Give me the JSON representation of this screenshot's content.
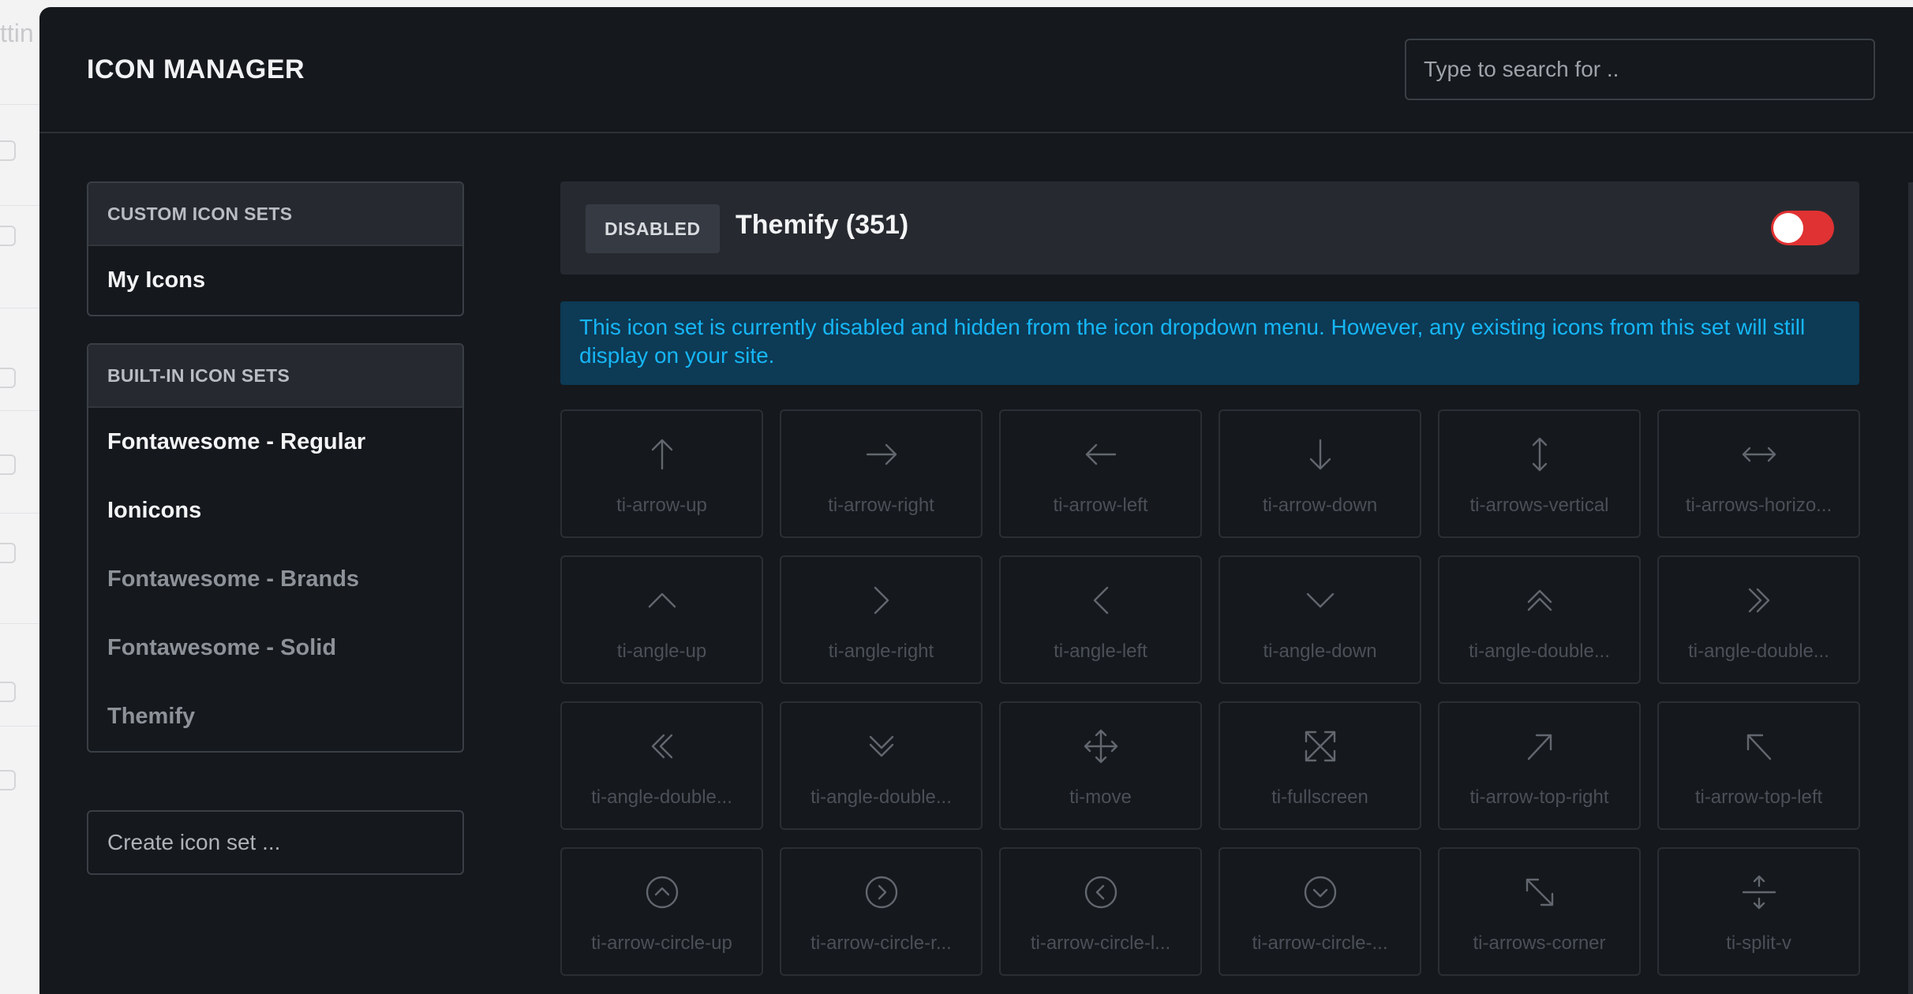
{
  "background": {
    "partial_text": "ttin"
  },
  "modal": {
    "title": "ICON MANAGER",
    "search_placeholder": "Type to search for .."
  },
  "sidebar": {
    "custom_sets": {
      "heading": "CUSTOM ICON SETS",
      "items": [
        {
          "label": "My Icons",
          "active": true
        }
      ]
    },
    "builtin_sets": {
      "heading": "BUILT-IN ICON SETS",
      "items": [
        {
          "label": "Fontawesome - Regular",
          "active": true
        },
        {
          "label": "Ionicons",
          "active": true
        },
        {
          "label": "Fontawesome - Brands",
          "active": false
        },
        {
          "label": "Fontawesome - Solid",
          "active": false
        },
        {
          "label": "Themify",
          "active": false
        }
      ]
    },
    "create_placeholder": "Create icon set ..."
  },
  "main": {
    "status_badge": "DISABLED",
    "set_title": "Themify (351)",
    "toggle_on": false,
    "toggle_color": "#e03232",
    "notice": "This icon set is currently disabled and hidden from the icon dropdown menu. However, any existing icons from this set will still display on your site.",
    "icons": [
      {
        "icon": "arrow-up",
        "label": "ti-arrow-up"
      },
      {
        "icon": "arrow-right",
        "label": "ti-arrow-right"
      },
      {
        "icon": "arrow-left",
        "label": "ti-arrow-left"
      },
      {
        "icon": "arrow-down",
        "label": "ti-arrow-down"
      },
      {
        "icon": "arrows-vertical",
        "label": "ti-arrows-vertical"
      },
      {
        "icon": "arrows-horizontal",
        "label": "ti-arrows-horizo..."
      },
      {
        "icon": "angle-up",
        "label": "ti-angle-up"
      },
      {
        "icon": "angle-right",
        "label": "ti-angle-right"
      },
      {
        "icon": "angle-left",
        "label": "ti-angle-left"
      },
      {
        "icon": "angle-down",
        "label": "ti-angle-down"
      },
      {
        "icon": "angle-double-up",
        "label": "ti-angle-double..."
      },
      {
        "icon": "angle-double-right",
        "label": "ti-angle-double..."
      },
      {
        "icon": "angle-double-left",
        "label": "ti-angle-double..."
      },
      {
        "icon": "angle-double-down",
        "label": "ti-angle-double..."
      },
      {
        "icon": "move",
        "label": "ti-move"
      },
      {
        "icon": "fullscreen",
        "label": "ti-fullscreen"
      },
      {
        "icon": "arrow-top-right",
        "label": "ti-arrow-top-right"
      },
      {
        "icon": "arrow-top-left",
        "label": "ti-arrow-top-left"
      },
      {
        "icon": "arrow-circle-up",
        "label": "ti-arrow-circle-up"
      },
      {
        "icon": "arrow-circle-right",
        "label": "ti-arrow-circle-r..."
      },
      {
        "icon": "arrow-circle-left",
        "label": "ti-arrow-circle-l..."
      },
      {
        "icon": "arrow-circle-down",
        "label": "ti-arrow-circle-..."
      },
      {
        "icon": "arrows-corner",
        "label": "ti-arrows-corner"
      },
      {
        "icon": "split-v",
        "label": "ti-split-v"
      }
    ]
  }
}
